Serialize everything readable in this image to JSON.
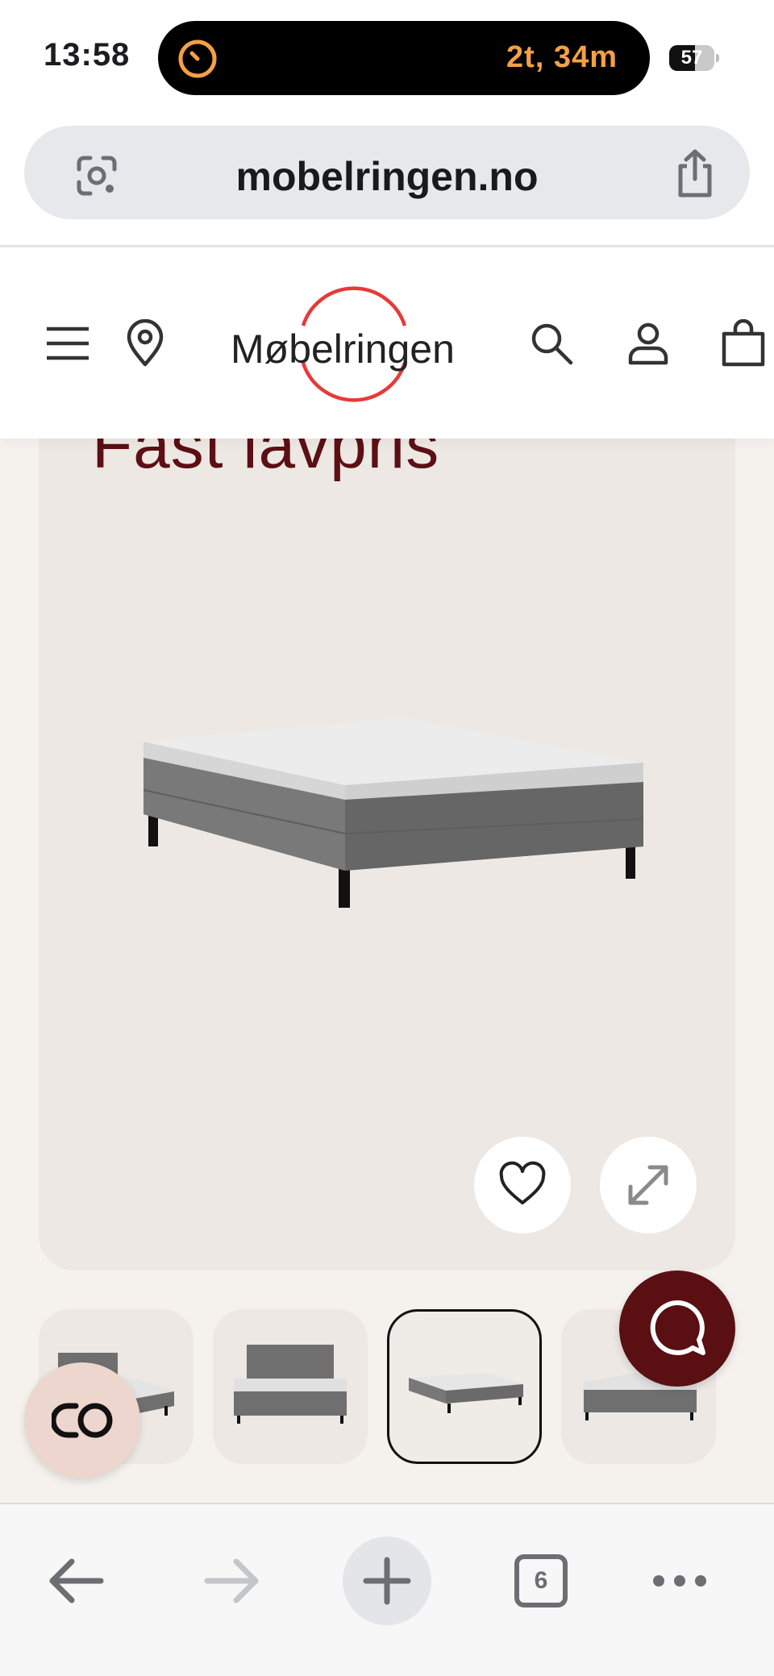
{
  "status_bar": {
    "time": "13:58",
    "activity_timer": "2t, 34m",
    "battery_percent": "57",
    "battery_level": 0.57
  },
  "browser": {
    "url": "mobelringen.no"
  },
  "site": {
    "logo_text": "Møbelringen",
    "brand_color": "#e63a3a"
  },
  "product": {
    "promo_title": "Fast lavpris",
    "thumbnails": [
      {
        "name": "thumb-bed-headboard-angle",
        "selected": false
      },
      {
        "name": "thumb-bed-headboard-front",
        "selected": false
      },
      {
        "name": "thumb-bed-angle",
        "selected": true
      },
      {
        "name": "thumb-bed-side",
        "selected": false
      }
    ]
  },
  "toolbar": {
    "tab_count": "6"
  },
  "colors": {
    "accent": "#5a0f13",
    "timer": "#f5a043",
    "card_bg": "#ede8e3"
  }
}
